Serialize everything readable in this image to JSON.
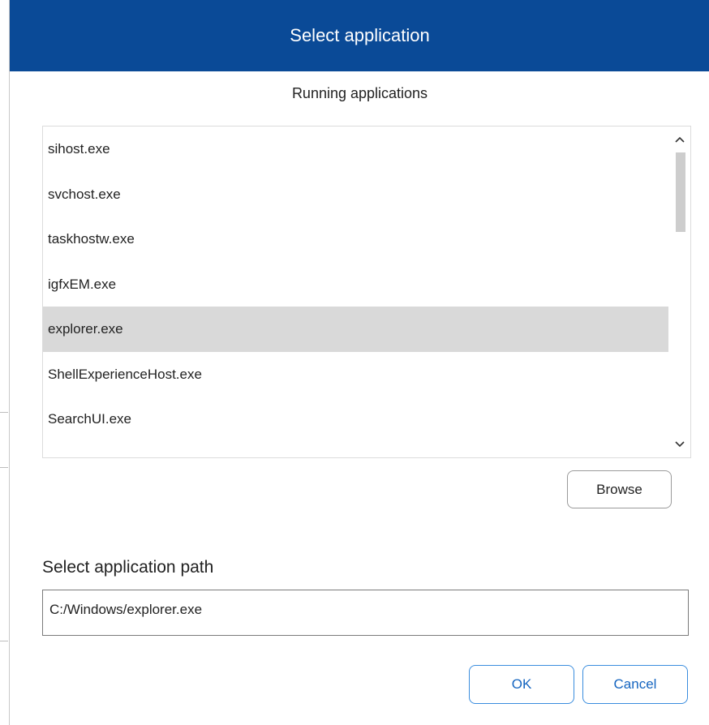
{
  "dialog": {
    "title": "Select application"
  },
  "running": {
    "heading": "Running applications",
    "items": [
      {
        "label": "sihost.exe",
        "selected": false
      },
      {
        "label": "svchost.exe",
        "selected": false
      },
      {
        "label": "taskhostw.exe",
        "selected": false
      },
      {
        "label": "igfxEM.exe",
        "selected": false
      },
      {
        "label": "explorer.exe",
        "selected": true
      },
      {
        "label": "ShellExperienceHost.exe",
        "selected": false
      },
      {
        "label": "SearchUI.exe",
        "selected": false
      }
    ],
    "scroll_up_icon": "chevron-up-icon",
    "scroll_down_icon": "chevron-down-icon"
  },
  "browse": {
    "label": "Browse"
  },
  "path": {
    "label": "Select application path",
    "value": "C:/Windows/explorer.exe"
  },
  "actions": {
    "ok_label": "OK",
    "cancel_label": "Cancel"
  },
  "colors": {
    "titlebar": "#0a4a97",
    "selected_row": "#d9d9d9",
    "action_border": "#3a8dde",
    "action_text": "#1565c0"
  }
}
